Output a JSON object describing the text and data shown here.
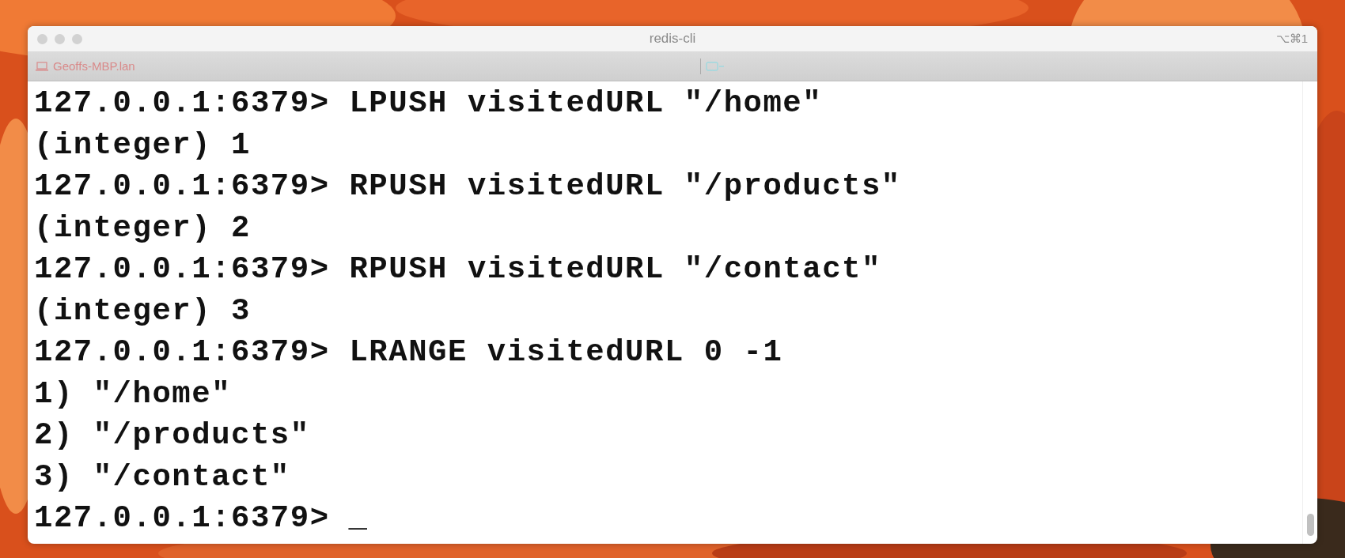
{
  "window": {
    "title": "redis-cli",
    "shortcut": "⌥⌘1"
  },
  "tab_bar": {
    "host": "Geoffs-MBP.lan"
  },
  "terminal": {
    "lines": [
      "127.0.0.1:6379> LPUSH visitedURL \"/home\"",
      "(integer) 1",
      "127.0.0.1:6379> RPUSH visitedURL \"/products\"",
      "(integer) 2",
      "127.0.0.1:6379> RPUSH visitedURL \"/contact\"",
      "(integer) 3",
      "127.0.0.1:6379> LRANGE visitedURL 0 -1",
      "1) \"/home\"",
      "2) \"/products\"",
      "3) \"/contact\""
    ],
    "prompt": "127.0.0.1:6379>",
    "cursor": "_"
  }
}
